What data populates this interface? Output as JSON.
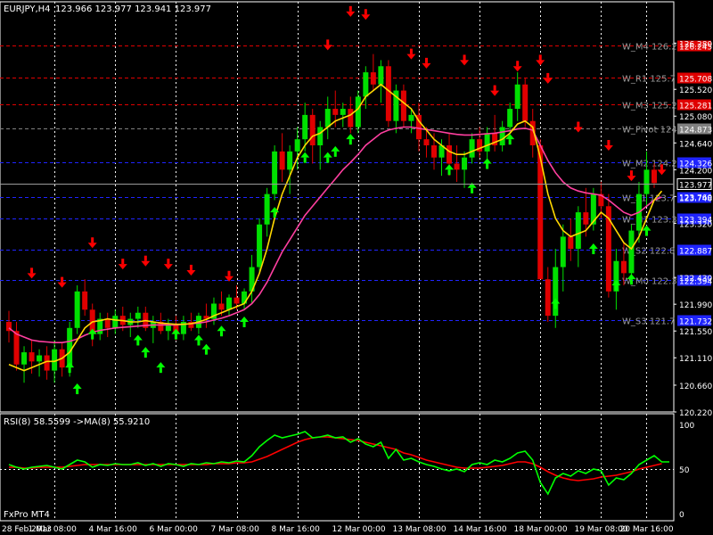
{
  "header": {
    "symbol_tf": "EURJPY,H4",
    "ohlc": "123.966 123.977 123.941 123.977"
  },
  "footer": {
    "brand": "FxPro MT4"
  },
  "colors": {
    "background": "#000000",
    "bull": "#00e000",
    "bear": "#e00000",
    "ma_fast": "#ffd700",
    "ma_slow": "#ff3fa0",
    "arrow_up": "#00ff00",
    "arrow_down": "#ff0000",
    "rsi": "#00ff00",
    "rsi_ma": "#ff0000",
    "pivot_red": "#e00000",
    "pivot_blue": "#1f24ff",
    "pivot_gray": "#808080"
  },
  "chart_data": [
    {
      "type": "candlestick",
      "title": "EURJPY,H4",
      "ylim": [
        120.22,
        126.9
      ],
      "y_ticks": [
        "126.280",
        "125.520",
        "125.080",
        "124.640",
        "124.200",
        "123.760",
        "123.320",
        "122.430",
        "121.990",
        "121.550",
        "121.110",
        "120.660",
        "120.220"
      ],
      "current_price": "123.977",
      "current_price_value": 123.977,
      "x_ticks": [
        "28 Feb 2013",
        "1 Mar 08:00",
        "4 Mar 16:00",
        "6 Mar 00:00",
        "7 Mar 08:00",
        "8 Mar 16:00",
        "12 Mar 00:00",
        "13 Mar 08:00",
        "14 Mar 16:00",
        "18 Mar 00:00",
        "19 Mar 08:00",
        "20 Mar 16:00"
      ],
      "pivot_levels": [
        {
          "name": "W_M4 126.2",
          "value": 126.245,
          "tag": "126.245",
          "color": "#e00000"
        },
        {
          "name": "W_R1 125.7",
          "value": 125.708,
          "tag": "125.708",
          "color": "#e00000"
        },
        {
          "name": "W_M3 125.2",
          "value": 125.281,
          "tag": "125.281",
          "color": "#e00000"
        },
        {
          "name": "W_Pivot 124",
          "value": 124.873,
          "tag": "124.873",
          "color": "#808080"
        },
        {
          "name": "W_M2 124.2",
          "value": 124.326,
          "tag": "124.326",
          "color": "#1f24ff"
        },
        {
          "name": "W_S1 123.7",
          "value": 123.748,
          "tag": "123.748",
          "color": "#1f24ff"
        },
        {
          "name": "W_M1 123.3",
          "value": 123.394,
          "tag": "123.394",
          "color": "#1f24ff"
        },
        {
          "name": "W_S2 122.8",
          "value": 122.887,
          "tag": "122.887",
          "color": "#1f24ff"
        },
        {
          "name": "W_M0 122.3",
          "value": 122.394,
          "tag": "122.394",
          "color": "#1f24ff"
        },
        {
          "name": "W_S3 121.7",
          "value": 121.732,
          "tag": "121.732",
          "color": "#1f24ff"
        }
      ],
      "candles": [
        [
          121.7,
          121.88,
          121.36,
          121.55
        ],
        [
          121.55,
          121.7,
          120.9,
          121.0
        ],
        [
          121.0,
          121.3,
          120.7,
          121.2
        ],
        [
          121.2,
          121.4,
          120.85,
          121.05
        ],
        [
          121.05,
          121.25,
          120.8,
          121.15
        ],
        [
          121.15,
          121.3,
          120.75,
          120.9
        ],
        [
          120.9,
          121.4,
          120.7,
          121.25
        ],
        [
          121.25,
          121.35,
          120.8,
          120.95
        ],
        [
          120.95,
          121.7,
          120.8,
          121.6
        ],
        [
          121.6,
          122.3,
          121.5,
          122.2
        ],
        [
          122.2,
          122.4,
          121.8,
          121.9
        ],
        [
          121.9,
          122.0,
          121.3,
          121.5
        ],
        [
          121.5,
          121.85,
          121.4,
          121.75
        ],
        [
          121.75,
          121.85,
          121.45,
          121.6
        ],
        [
          121.6,
          121.9,
          121.5,
          121.8
        ],
        [
          121.8,
          121.95,
          121.55,
          121.65
        ],
        [
          121.65,
          121.85,
          121.45,
          121.75
        ],
        [
          121.75,
          121.95,
          121.6,
          121.85
        ],
        [
          121.85,
          121.95,
          121.55,
          121.6
        ],
        [
          121.6,
          121.8,
          121.35,
          121.7
        ],
        [
          121.7,
          121.85,
          121.5,
          121.55
        ],
        [
          121.55,
          121.75,
          121.4,
          121.65
        ],
        [
          121.65,
          121.8,
          121.4,
          121.5
        ],
        [
          121.5,
          121.8,
          121.4,
          121.7
        ],
        [
          121.7,
          121.85,
          121.55,
          121.6
        ],
        [
          121.6,
          121.85,
          121.5,
          121.8
        ],
        [
          121.8,
          122.0,
          121.6,
          121.75
        ],
        [
          121.75,
          122.1,
          121.65,
          122.0
        ],
        [
          122.0,
          122.2,
          121.8,
          121.9
        ],
        [
          121.9,
          122.15,
          121.8,
          122.1
        ],
        [
          122.1,
          122.3,
          121.9,
          122.0
        ],
        [
          122.0,
          122.25,
          121.9,
          122.2
        ],
        [
          122.2,
          122.8,
          122.0,
          122.6
        ],
        [
          122.6,
          123.4,
          122.5,
          123.3
        ],
        [
          123.3,
          123.9,
          123.1,
          123.8
        ],
        [
          123.8,
          124.6,
          123.7,
          124.5
        ],
        [
          124.5,
          124.8,
          124.0,
          124.2
        ],
        [
          124.2,
          124.6,
          123.8,
          124.5
        ],
        [
          124.5,
          124.9,
          124.2,
          124.7
        ],
        [
          124.7,
          125.3,
          124.5,
          125.1
        ],
        [
          125.1,
          125.2,
          124.3,
          124.6
        ],
        [
          124.6,
          125.0,
          124.2,
          124.9
        ],
        [
          124.9,
          125.4,
          124.7,
          125.2
        ],
        [
          125.2,
          125.5,
          124.9,
          125.1
        ],
        [
          125.1,
          125.3,
          124.9,
          125.2
        ],
        [
          125.2,
          125.4,
          124.8,
          124.9
        ],
        [
          124.9,
          125.5,
          124.8,
          125.4
        ],
        [
          125.4,
          125.9,
          125.2,
          125.8
        ],
        [
          125.8,
          126.1,
          125.5,
          125.6
        ],
        [
          125.6,
          126.0,
          125.3,
          125.9
        ],
        [
          125.9,
          126.0,
          124.9,
          125.0
        ],
        [
          125.0,
          125.6,
          124.8,
          125.5
        ],
        [
          125.5,
          125.6,
          124.9,
          125.0
        ],
        [
          125.0,
          125.2,
          124.8,
          125.1
        ],
        [
          125.1,
          125.3,
          124.5,
          124.7
        ],
        [
          124.7,
          124.9,
          124.4,
          124.6
        ],
        [
          124.6,
          124.8,
          124.2,
          124.4
        ],
        [
          124.4,
          124.7,
          124.1,
          124.6
        ],
        [
          124.6,
          124.8,
          124.1,
          124.3
        ],
        [
          124.3,
          124.6,
          124.0,
          124.2
        ],
        [
          124.2,
          124.5,
          123.9,
          124.4
        ],
        [
          124.4,
          124.8,
          124.3,
          124.7
        ],
        [
          124.7,
          124.9,
          124.4,
          124.5
        ],
        [
          124.5,
          124.9,
          124.3,
          124.8
        ],
        [
          124.8,
          125.1,
          124.5,
          124.6
        ],
        [
          124.6,
          125.0,
          124.5,
          124.9
        ],
        [
          124.9,
          125.3,
          124.8,
          125.2
        ],
        [
          125.2,
          125.8,
          125.0,
          125.6
        ],
        [
          125.6,
          125.7,
          124.9,
          125.0
        ],
        [
          125.0,
          125.2,
          124.4,
          124.6
        ],
        [
          124.6,
          124.7,
          122.5,
          122.4
        ],
        [
          122.4,
          122.6,
          121.7,
          121.8
        ],
        [
          121.8,
          122.9,
          121.6,
          122.6
        ],
        [
          122.6,
          123.3,
          122.2,
          123.1
        ],
        [
          123.1,
          123.4,
          122.7,
          122.9
        ],
        [
          122.9,
          123.6,
          122.6,
          123.5
        ],
        [
          123.5,
          123.9,
          123.1,
          123.3
        ],
        [
          123.3,
          123.9,
          123.2,
          123.8
        ],
        [
          123.8,
          124.0,
          123.4,
          123.6
        ],
        [
          123.6,
          123.8,
          122.1,
          122.2
        ],
        [
          122.2,
          122.9,
          121.9,
          122.7
        ],
        [
          122.7,
          123.0,
          122.3,
          122.5
        ],
        [
          122.5,
          123.3,
          122.4,
          123.2
        ],
        [
          123.2,
          124.0,
          123.0,
          123.8
        ],
        [
          123.8,
          124.5,
          123.6,
          124.2
        ],
        [
          124.2,
          124.3,
          123.9,
          123.98
        ]
      ],
      "ma_fast": [
        121.0,
        120.95,
        120.9,
        120.95,
        121.0,
        121.05,
        121.05,
        121.1,
        121.2,
        121.4,
        121.6,
        121.7,
        121.72,
        121.75,
        121.73,
        121.72,
        121.7,
        121.7,
        121.72,
        121.7,
        121.68,
        121.67,
        121.66,
        121.66,
        121.67,
        121.7,
        121.74,
        121.8,
        121.85,
        121.9,
        121.95,
        122.0,
        122.2,
        122.5,
        122.9,
        123.4,
        123.8,
        124.1,
        124.4,
        124.6,
        124.75,
        124.8,
        124.9,
        125.0,
        125.05,
        125.1,
        125.2,
        125.4,
        125.5,
        125.6,
        125.5,
        125.4,
        125.3,
        125.2,
        125.0,
        124.85,
        124.7,
        124.6,
        124.5,
        124.45,
        124.45,
        124.5,
        124.55,
        124.6,
        124.65,
        124.7,
        124.8,
        124.95,
        125.0,
        124.9,
        124.4,
        123.8,
        123.4,
        123.2,
        123.1,
        123.15,
        123.2,
        123.35,
        123.5,
        123.4,
        123.2,
        123.0,
        122.9,
        123.1,
        123.4,
        123.7,
        123.85
      ],
      "ma_slow": [
        121.6,
        121.5,
        121.45,
        121.4,
        121.38,
        121.37,
        121.36,
        121.36,
        121.38,
        121.42,
        121.48,
        121.53,
        121.56,
        121.58,
        121.6,
        121.61,
        121.62,
        121.63,
        121.64,
        121.65,
        121.65,
        121.65,
        121.65,
        121.66,
        121.67,
        121.68,
        121.7,
        121.73,
        121.76,
        121.8,
        121.85,
        121.9,
        122.0,
        122.15,
        122.35,
        122.6,
        122.85,
        123.05,
        123.25,
        123.45,
        123.6,
        123.75,
        123.9,
        124.05,
        124.2,
        124.32,
        124.45,
        124.6,
        124.7,
        124.8,
        124.85,
        124.88,
        124.9,
        124.9,
        124.88,
        124.86,
        124.84,
        124.82,
        124.8,
        124.78,
        124.77,
        124.77,
        124.78,
        124.79,
        124.8,
        124.82,
        124.84,
        124.87,
        124.88,
        124.85,
        124.6,
        124.35,
        124.15,
        124.0,
        123.9,
        123.85,
        123.82,
        123.8,
        123.78,
        123.7,
        123.6,
        123.5,
        123.45,
        123.5,
        123.6,
        123.7,
        123.75
      ],
      "arrows_up": [
        [
          8,
          120.95
        ],
        [
          9,
          120.6
        ],
        [
          11,
          121.5
        ],
        [
          17,
          121.4
        ],
        [
          18,
          121.2
        ],
        [
          20,
          120.95
        ],
        [
          22,
          121.5
        ],
        [
          25,
          121.4
        ],
        [
          26,
          121.25
        ],
        [
          28,
          121.55
        ],
        [
          31,
          121.7
        ],
        [
          35,
          123.5
        ],
        [
          39,
          124.4
        ],
        [
          42,
          124.4
        ],
        [
          43,
          124.5
        ],
        [
          45,
          124.7
        ],
        [
          58,
          124.2
        ],
        [
          61,
          123.9
        ],
        [
          63,
          124.3
        ],
        [
          66,
          124.7
        ],
        [
          72,
          122.0
        ],
        [
          77,
          122.9
        ],
        [
          80,
          122.3
        ],
        [
          82,
          122.4
        ],
        [
          84,
          123.2
        ]
      ],
      "arrows_down": [
        [
          3,
          122.5
        ],
        [
          7,
          122.35
        ],
        [
          11,
          123.0
        ],
        [
          15,
          122.65
        ],
        [
          18,
          122.7
        ],
        [
          21,
          122.65
        ],
        [
          24,
          122.55
        ],
        [
          29,
          122.45
        ],
        [
          42,
          126.25
        ],
        [
          45,
          126.8
        ],
        [
          47,
          126.75
        ],
        [
          53,
          126.1
        ],
        [
          55,
          125.95
        ],
        [
          60,
          126.0
        ],
        [
          64,
          125.5
        ],
        [
          67,
          125.9
        ],
        [
          70,
          126.0
        ],
        [
          71,
          125.7
        ],
        [
          75,
          124.9
        ],
        [
          79,
          124.6
        ],
        [
          82,
          124.1
        ],
        [
          86,
          124.2
        ]
      ]
    },
    {
      "type": "line",
      "title": "RSI(8) 58.5599  ->MA(8) 55.9210",
      "ylim": [
        0,
        100
      ],
      "y_ticks": [
        "100",
        "50",
        "0"
      ],
      "series": [
        {
          "name": "RSI(8) 58.5599",
          "values": [
            55,
            52,
            50,
            52,
            53,
            54,
            52,
            50,
            55,
            60,
            58,
            52,
            55,
            54,
            56,
            55,
            55,
            57,
            54,
            56,
            53,
            56,
            55,
            53,
            56,
            55,
            57,
            56,
            58,
            57,
            59,
            58,
            65,
            75,
            82,
            88,
            85,
            87,
            89,
            92,
            85,
            86,
            88,
            85,
            86,
            80,
            84,
            78,
            75,
            80,
            62,
            72,
            60,
            62,
            58,
            55,
            53,
            50,
            48,
            50,
            47,
            55,
            57,
            55,
            60,
            58,
            62,
            68,
            70,
            60,
            35,
            22,
            40,
            45,
            42,
            48,
            45,
            50,
            48,
            32,
            40,
            38,
            45,
            55,
            60,
            65,
            58,
            58
          ]
        },
        {
          "name": "->MA(8) 55.9210",
          "values": [
            52,
            52,
            51,
            51,
            52,
            52,
            52,
            52,
            53,
            54,
            55,
            55,
            55,
            55,
            55,
            55,
            55,
            55,
            55,
            55,
            55,
            55,
            55,
            55,
            55,
            55,
            55,
            56,
            56,
            56,
            57,
            57,
            58,
            61,
            64,
            68,
            72,
            76,
            80,
            83,
            85,
            86,
            86,
            85,
            84,
            83,
            82,
            80,
            78,
            76,
            74,
            72,
            68,
            66,
            63,
            60,
            58,
            56,
            54,
            52,
            51,
            51,
            51,
            52,
            53,
            54,
            56,
            58,
            58,
            56,
            52,
            47,
            43,
            40,
            38,
            37,
            38,
            39,
            41,
            42,
            43,
            45,
            47,
            50,
            52,
            54,
            56
          ]
        }
      ]
    }
  ]
}
